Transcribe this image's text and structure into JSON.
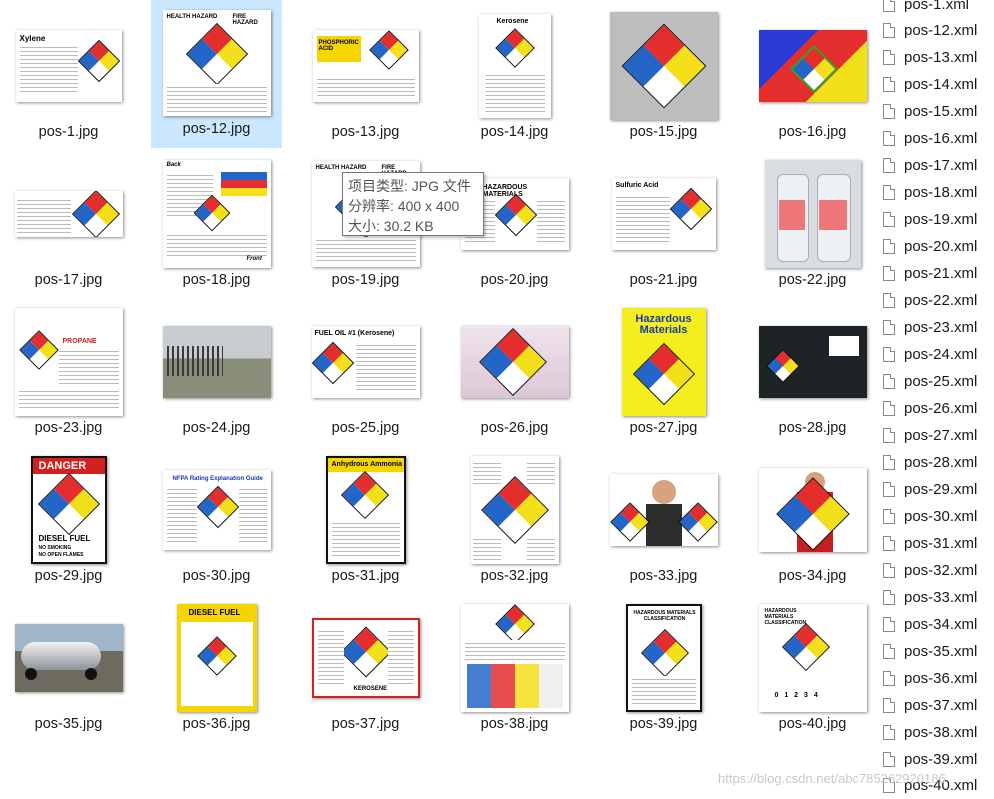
{
  "tiles": [
    {
      "name": "pos-1.jpg"
    },
    {
      "name": "pos-12.jpg"
    },
    {
      "name": "pos-13.jpg"
    },
    {
      "name": "pos-14.jpg"
    },
    {
      "name": "pos-15.jpg"
    },
    {
      "name": "pos-16.jpg"
    },
    {
      "name": "pos-17.jpg"
    },
    {
      "name": "pos-18.jpg"
    },
    {
      "name": "pos-19.jpg"
    },
    {
      "name": "pos-20.jpg"
    },
    {
      "name": "pos-21.jpg"
    },
    {
      "name": "pos-22.jpg"
    },
    {
      "name": "pos-23.jpg"
    },
    {
      "name": "pos-24.jpg"
    },
    {
      "name": "pos-25.jpg"
    },
    {
      "name": "pos-26.jpg"
    },
    {
      "name": "pos-27.jpg"
    },
    {
      "name": "pos-28.jpg"
    },
    {
      "name": "pos-29.jpg"
    },
    {
      "name": "pos-30.jpg"
    },
    {
      "name": "pos-31.jpg"
    },
    {
      "name": "pos-32.jpg"
    },
    {
      "name": "pos-33.jpg"
    },
    {
      "name": "pos-34.jpg"
    },
    {
      "name": "pos-35.jpg"
    },
    {
      "name": "pos-36.jpg"
    },
    {
      "name": "pos-37.jpg"
    },
    {
      "name": "pos-38.jpg"
    },
    {
      "name": "pos-39.jpg"
    },
    {
      "name": "pos-40.jpg"
    }
  ],
  "thumb_text": {
    "t1_title": "Xylene",
    "t14_title": "Kerosene",
    "t13_title": "PHOSPHORIC ACID",
    "t21_title": "Sulfuric Acid",
    "t20_title": "HAZARDOUS MATERIALS",
    "t25_title": "FUEL OIL #1 (Kerosene)",
    "t27_title": "Hazardous Materials",
    "t29_title": "DANGER",
    "t29_sub": "DIESEL FUEL",
    "t29_l1": "NO SMOKING",
    "t29_l2": "NO OPEN FLAMES",
    "t30_title": "NFPA Rating Explanation Guide",
    "t31_title": "Anhydrous Ammonia",
    "t36_title": "DIESEL FUEL",
    "t37_bottom": "KEROSENE",
    "t39_title": "HAZARDOUS MATERIALS CLASSIFICATION",
    "t40_title": "HAZARDOUS MATERIALS CLASSIFICATION",
    "t18_front": "Front",
    "t18_back": "Back",
    "t12_health": "HEALTH HAZARD",
    "t12_fire": "FIRE HAZARD",
    "t19_health": "HEALTH HAZARD",
    "t19_fire": "FIRE HAZARD",
    "t23_title": "PROPANE",
    "t40_scale": "0 1 2 3 4"
  },
  "files": [
    "pos-1.xml",
    "pos-12.xml",
    "pos-13.xml",
    "pos-14.xml",
    "pos-15.xml",
    "pos-16.xml",
    "pos-17.xml",
    "pos-18.xml",
    "pos-19.xml",
    "pos-20.xml",
    "pos-21.xml",
    "pos-22.xml",
    "pos-23.xml",
    "pos-24.xml",
    "pos-25.xml",
    "pos-26.xml",
    "pos-27.xml",
    "pos-28.xml",
    "pos-29.xml",
    "pos-30.xml",
    "pos-31.xml",
    "pos-32.xml",
    "pos-33.xml",
    "pos-34.xml",
    "pos-35.xml",
    "pos-36.xml",
    "pos-37.xml",
    "pos-38.xml",
    "pos-39.xml",
    "pos-40.xml"
  ],
  "tooltip": {
    "type": "项目类型: JPG 文件",
    "resolution": "分辨率: 400 x 400",
    "size": "大小: 30.2 KB"
  },
  "watermark": "https://blog.csdn.net/abc785262920186"
}
